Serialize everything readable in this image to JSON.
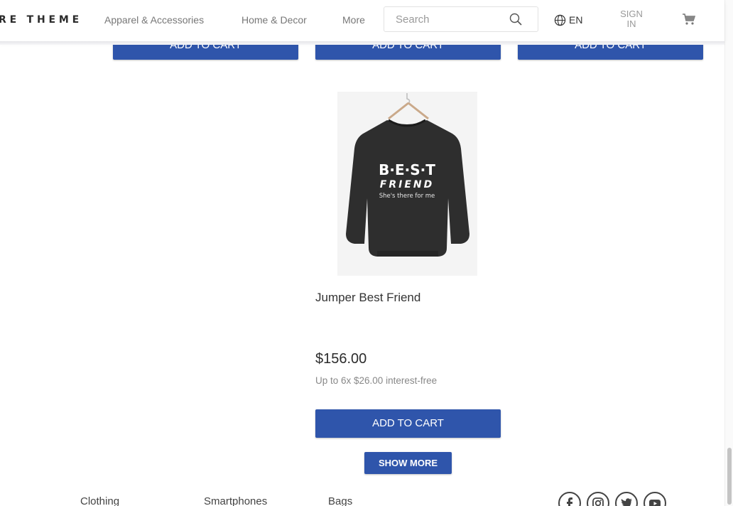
{
  "header": {
    "logo": "RE THEME",
    "nav": [
      "Apparel & Accessories",
      "Home & Decor",
      "More"
    ],
    "search_placeholder": "Search",
    "language": "EN",
    "signin": "SIGN IN"
  },
  "top_row": {
    "add_to_cart_label": "ADD TO CART"
  },
  "product": {
    "name": "Jumper Best Friend",
    "price": "$156.00",
    "installments": "Up to 6x $26.00 interest-free",
    "add_to_cart_label": "ADD TO CART",
    "image_text": {
      "line1": "B·E·S·T",
      "line2": "FRIEND",
      "line3": "She's there for me"
    }
  },
  "show_more_label": "SHOW MORE",
  "footer": {
    "links": [
      "Clothing",
      "Smartphones",
      "Bags"
    ],
    "social": [
      "facebook-icon",
      "instagram-icon",
      "twitter-icon",
      "youtube-icon"
    ]
  },
  "colors": {
    "accent": "#2f55ab",
    "text": "#333333",
    "muted": "#888888"
  }
}
